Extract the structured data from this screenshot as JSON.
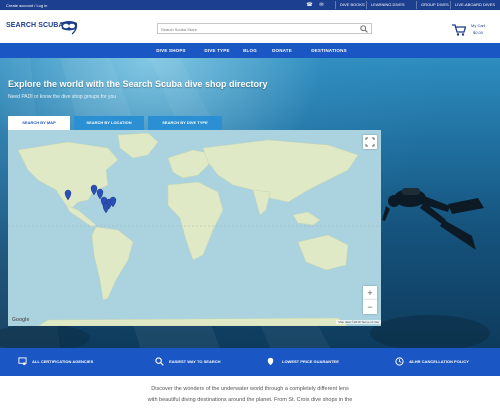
{
  "topbar": {
    "account_text": "Create account / Log in",
    "phone_icon": "phone-icon",
    "mail_icon": "mail-icon",
    "buttons": [
      "DIVE BOOKS",
      "LEARNING DIVES",
      "GROUP DIVES",
      "LIVE-ABOARD DIVES"
    ]
  },
  "header": {
    "logo_text": "SEARCH SCUBA",
    "logo_mark": "mask-icon",
    "search_placeholder": "Search Scuba Store",
    "cart_label": "My Cart",
    "cart_amount": "$0.00"
  },
  "nav": {
    "items": [
      "DIVE SHOPS",
      "DIVE TYPE",
      "BLOG",
      "DONATE",
      "DESTINATIONS"
    ]
  },
  "hero": {
    "title": "Explore the world with the Search Scuba dive shop directory",
    "subtitle": "Need PADI or know the dive shop groups for you",
    "tabs": [
      "SEARCH BY MAP",
      "SEARCH BY LOCATION",
      "SEARCH BY DIVE TYPE"
    ],
    "active_tab": 0
  },
  "map": {
    "brand": "Google",
    "attribution": "Map data ©2019   Terms of Use",
    "zoom_in": "+",
    "zoom_out": "−"
  },
  "features": [
    {
      "icon": "certificate-icon",
      "label": "ALL CERTIFICATION AGENCIES"
    },
    {
      "icon": "search-icon",
      "label": "EASIEST WAY TO SEARCH"
    },
    {
      "icon": "price-tag-icon",
      "label": "LOWEST PRICE GUARANTEE"
    },
    {
      "icon": "clock-icon",
      "label": "48-HR CANCELLATION POLICY"
    }
  ],
  "intro": {
    "line1": "Discover the wonders of the underwater world through a completely different lens",
    "line2": "with beautiful diving destinations around the planet. From St. Croix dive shops in the"
  },
  "colors": {
    "topbar": "#1c3f8f",
    "nav": "#1a56c4",
    "features": "#1a56c4",
    "tab_inactive": "#2b8fd3",
    "ocean": "#aad3df",
    "land": "#dfe9c6"
  }
}
